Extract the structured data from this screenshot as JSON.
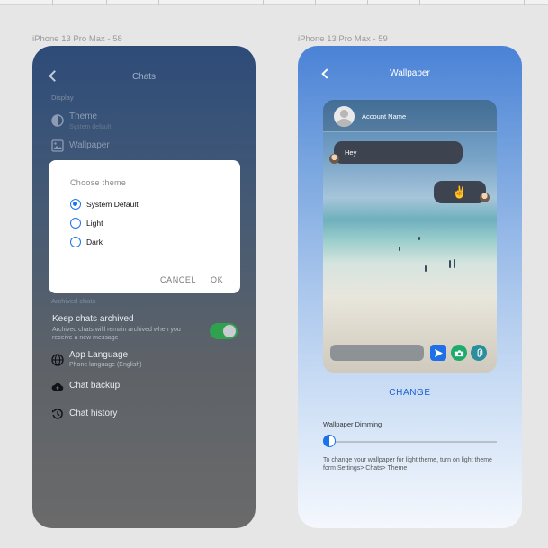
{
  "left_frame": {
    "label": "iPhone 13 Pro Max - 58",
    "header": {
      "title": "Chats"
    },
    "sections": {
      "display": "Display",
      "archived": "Archived chats"
    },
    "rows": {
      "theme": {
        "title": "Theme",
        "subtitle": "System default"
      },
      "wallpaper": {
        "title": "Wallpaper"
      },
      "keep_archived": {
        "title": "Keep chats archived",
        "subtitle": "Archived chats willl remain archived when you receive a new message"
      },
      "app_language": {
        "title": "App Language",
        "subtitle": "Phone language (English)"
      },
      "chat_backup": {
        "title": "Chat backup"
      },
      "chat_history": {
        "title": "Chat history"
      }
    },
    "keep_archived_toggle": true,
    "dialog": {
      "title": "Choose theme",
      "options": [
        "System Default",
        "Light",
        "Dark"
      ],
      "selected": "System Default",
      "cancel": "CANCEL",
      "ok": "OK"
    }
  },
  "right_frame": {
    "label": "iPhone 13 Pro Max - 59",
    "header": {
      "title": "Wallpaper"
    },
    "preview": {
      "account_name": "Account Name",
      "incoming_message": "Hey",
      "outgoing_message": "✌️"
    },
    "change_button": "CHANGE",
    "dimming_label": "Wallpaper Dimming",
    "dimming_value": 0.0,
    "note": "To change your wallpaper for light theme, turn on light theme form Settings> Chats> Theme"
  },
  "colors": {
    "accent": "#1a73e8",
    "toggle_on": "#2fa14f",
    "send_button": "#1f6fe8",
    "camera_button": "#1bab6a"
  }
}
